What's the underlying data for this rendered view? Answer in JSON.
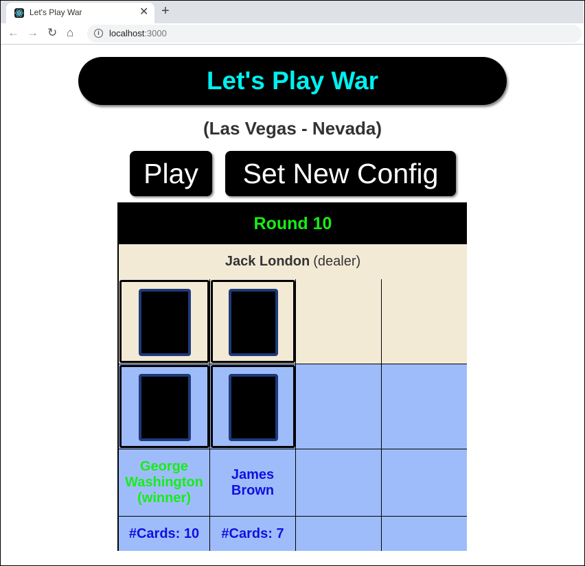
{
  "browser": {
    "tab_title": "Let's Play War",
    "url_host": "localhost",
    "url_port": ":3000",
    "icons": [
      "react-favicon-icon",
      "close-icon",
      "plus-icon",
      "back-icon",
      "forward-icon",
      "reload-icon",
      "home-icon",
      "info-icon"
    ]
  },
  "header": {
    "title": "Let's Play War",
    "location": "(Las Vegas - Nevada)"
  },
  "buttons": {
    "play": "Play",
    "config": "Set New Config"
  },
  "game": {
    "round": "Round 10",
    "dealer": {
      "name": "Jack London",
      "role": "(dealer)"
    },
    "players": [
      {
        "name": "George Washington (winner)",
        "cards": "#Cards: 10",
        "status": "winner"
      },
      {
        "name": "James Brown",
        "cards": "#Cards: 7",
        "status": "player"
      }
    ]
  },
  "colors": {
    "title_text": "#00f0f0",
    "round_text": "#16ee16",
    "winner_text": "#16ee16",
    "player_text": "#1010e0",
    "cream_row": "#f3ead6",
    "blue_row": "#9fbcfa",
    "card_border": "#1e3a7a"
  }
}
